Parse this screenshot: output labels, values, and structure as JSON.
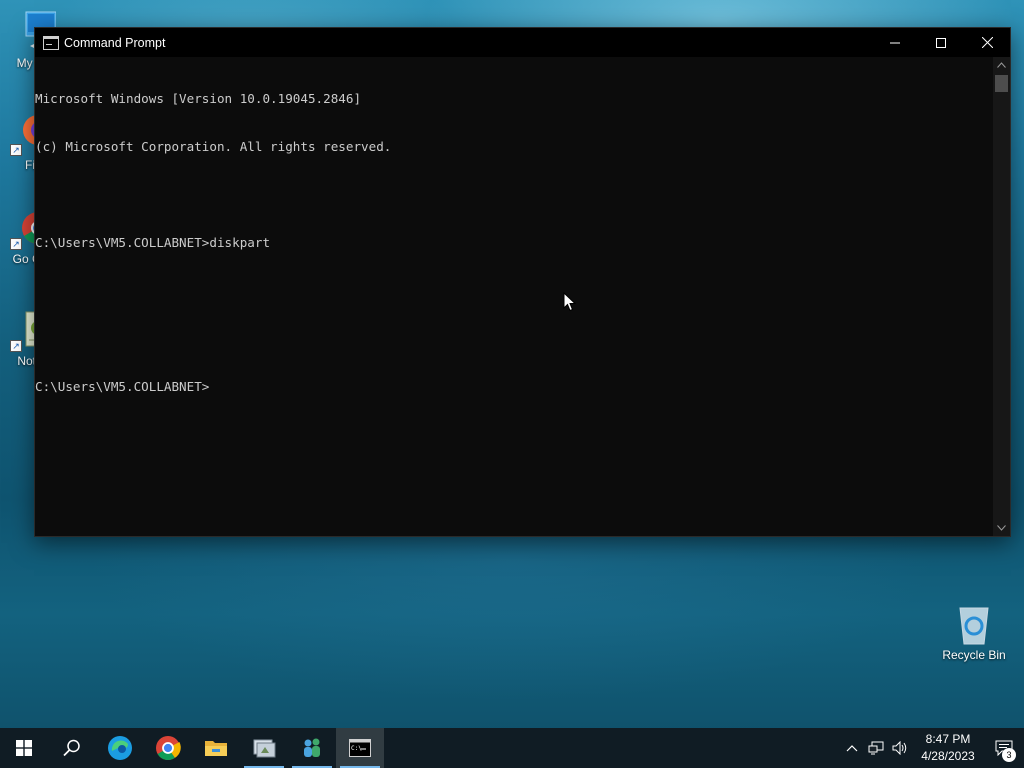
{
  "desktop": {
    "icons": [
      {
        "label": "My Co",
        "icon": "this-pc-icon"
      },
      {
        "label": "Fi",
        "icon": "firefox-icon"
      },
      {
        "label": "Go Ch",
        "icon": "chrome-icon"
      },
      {
        "label": "Note",
        "icon": "notepad-icon"
      },
      {
        "label": "Recycle Bin",
        "icon": "recycle-bin-icon"
      }
    ]
  },
  "window": {
    "title": "Command Prompt",
    "buttons": {
      "minimize": "minimize-icon",
      "maximize": "maximize-icon",
      "close": "close-icon"
    },
    "console_lines": [
      "Microsoft Windows [Version 10.0.19045.2846]",
      "(c) Microsoft Corporation. All rights reserved.",
      "",
      "C:\\Users\\VM5.COLLABNET>diskpart",
      "",
      "",
      "C:\\Users\\VM5.COLLABNET>"
    ],
    "colors": {
      "background": "#0c0c0c",
      "text": "#cccccc"
    }
  },
  "taskbar": {
    "items": [
      {
        "name": "start",
        "icon": "windows-logo-icon"
      },
      {
        "name": "search",
        "icon": "search-icon"
      },
      {
        "name": "edge",
        "icon": "edge-icon"
      },
      {
        "name": "chrome",
        "icon": "chrome-icon"
      },
      {
        "name": "file-explorer",
        "icon": "folder-icon"
      },
      {
        "name": "app-1",
        "icon": "app-icon"
      },
      {
        "name": "app-2",
        "icon": "people-icon"
      },
      {
        "name": "command-prompt",
        "icon": "cmd-icon",
        "active": true
      }
    ],
    "tray": {
      "icons": [
        "chevron-up-icon",
        "network-icon",
        "volume-icon"
      ],
      "time": "8:47 PM",
      "date": "4/28/2023",
      "notification_count": "3"
    },
    "accent": "#76b9ed"
  }
}
